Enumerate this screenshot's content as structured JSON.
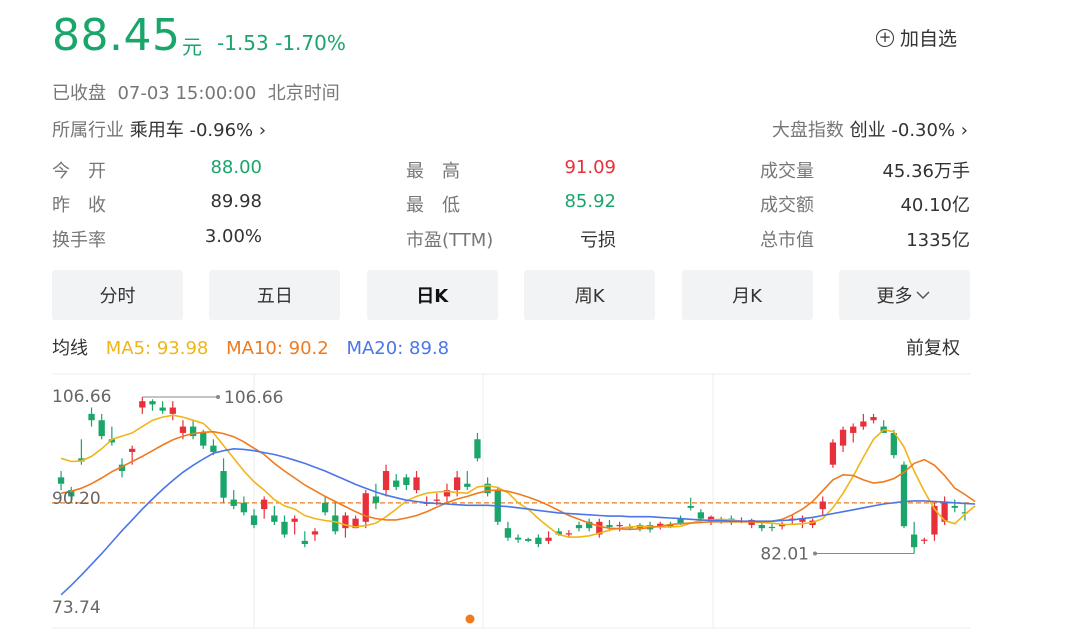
{
  "quote": {
    "price": "88.45",
    "unit": "元",
    "change": "-1.53",
    "change_pct": "-1.70%",
    "add_favorite": "加自选",
    "status": "已收盘",
    "datetime": "07-03 15:00:00",
    "timezone": "北京时间"
  },
  "industry": {
    "label": "所属行业",
    "name": "乘用车",
    "change": "-0.96%",
    "arrow": "›"
  },
  "index": {
    "label": "大盘指数",
    "name": "创业",
    "change": "-0.30%",
    "arrow": "›"
  },
  "stats": [
    {
      "label": "今　开",
      "value": "88.00",
      "color": "green"
    },
    {
      "label": "昨　收",
      "value": "89.98",
      "color": "normal"
    },
    {
      "label": "换手率",
      "value": "3.00%",
      "color": "normal"
    },
    {
      "label": "最　高",
      "value": "91.09",
      "color": "red"
    },
    {
      "label": "最　低",
      "value": "85.92",
      "color": "green"
    },
    {
      "label": "市盈(TTM)",
      "value": "亏损",
      "color": "normal"
    },
    {
      "label": "成交量",
      "value": "45.36万手",
      "color": "normal"
    },
    {
      "label": "成交额",
      "value": "40.10亿",
      "color": "normal"
    },
    {
      "label": "总市值",
      "value": "1335亿",
      "color": "normal"
    }
  ],
  "tabs": [
    "分时",
    "五日",
    "日K",
    "周K",
    "月K",
    "更多"
  ],
  "active_tab": "日K",
  "ma": {
    "title": "均线",
    "ma5": "MA5: 93.98",
    "ma10": "MA10: 90.2",
    "ma20": "MA20: 89.8",
    "adjust": "前复权"
  },
  "colors": {
    "up": "#e8303a",
    "down": "#1aa56b",
    "ma5": "#f0b518",
    "ma10": "#f07a1f",
    "ma20": "#4a76e8"
  },
  "chart_data": {
    "type": "candlestick",
    "y_labels": [
      "106.66",
      "90.20",
      "73.74"
    ],
    "max_annotation": "106.66",
    "min_annotation": "82.01",
    "ylim": [
      73.74,
      106.66
    ],
    "reference_price": 89.98,
    "candles": [
      [
        94,
        95,
        92,
        93
      ],
      [
        92,
        92.5,
        90,
        91
      ],
      [
        97,
        100,
        96,
        96.5
      ],
      [
        104,
        105,
        102,
        103
      ],
      [
        103,
        104,
        100,
        100.5
      ],
      [
        100,
        102,
        99,
        99.5
      ],
      [
        96,
        97,
        94,
        95
      ],
      [
        98,
        99,
        96,
        98.5
      ],
      [
        105,
        106.66,
        104,
        106
      ],
      [
        106,
        106.3,
        104.5,
        105.5
      ],
      [
        105,
        106,
        104,
        104.5
      ],
      [
        104,
        106,
        103,
        105
      ],
      [
        101,
        103,
        100,
        102
      ],
      [
        102,
        103,
        100,
        100.5
      ],
      [
        101,
        101.5,
        98.5,
        99
      ],
      [
        99,
        100,
        97.5,
        98
      ],
      [
        95,
        97,
        90,
        90.8
      ],
      [
        90.5,
        92,
        89,
        89.5
      ],
      [
        90,
        91,
        88,
        88.5
      ],
      [
        88,
        89,
        86,
        86.5
      ],
      [
        89,
        91,
        87.5,
        90.5
      ],
      [
        88,
        89.5,
        86.5,
        87
      ],
      [
        87,
        88,
        84.5,
        85
      ],
      [
        87,
        88,
        85,
        87.5
      ],
      [
        84,
        85.5,
        83,
        83.5
      ],
      [
        85,
        86,
        84,
        85.5
      ],
      [
        90,
        91,
        88,
        88.5
      ],
      [
        88,
        90,
        85,
        85.5
      ],
      [
        86,
        88.5,
        84.5,
        88
      ],
      [
        86,
        88,
        86,
        87.5
      ],
      [
        87,
        92,
        86,
        91.5
      ],
      [
        91,
        93,
        89,
        90
      ],
      [
        92,
        96,
        91,
        95
      ],
      [
        93.5,
        94.5,
        92,
        92.5
      ],
      [
        94,
        94.5,
        92,
        92.8
      ],
      [
        92,
        95,
        91.5,
        94
      ],
      [
        90,
        91,
        89.5,
        90
      ],
      [
        90.5,
        91.5,
        89.6,
        90.5
      ],
      [
        91,
        93,
        90,
        92
      ],
      [
        92,
        95,
        91,
        94
      ],
      [
        93,
        95,
        92,
        92.5
      ],
      [
        100,
        101,
        96.5,
        97
      ],
      [
        93,
        94,
        91,
        91.5
      ],
      [
        92,
        92.5,
        86.5,
        87
      ],
      [
        86,
        87,
        84,
        84.5
      ],
      [
        84.5,
        85,
        83.7,
        84.2
      ],
      [
        84.3,
        84.5,
        83.8,
        84
      ],
      [
        84.5,
        85,
        83,
        83.5
      ],
      [
        84,
        85.5,
        83.5,
        84.5
      ],
      [
        85.5,
        86,
        84.8,
        85
      ],
      [
        85,
        85.7,
        84.5,
        85.2
      ],
      [
        86.5,
        87,
        85.5,
        86
      ],
      [
        87,
        87.5,
        85.5,
        86
      ],
      [
        85,
        87.5,
        84.5,
        87
      ],
      [
        86.5,
        87.3,
        85.5,
        86.2
      ],
      [
        86.5,
        87,
        85.5,
        86.5
      ],
      [
        86.2,
        86.7,
        85.7,
        86
      ],
      [
        86.5,
        86.8,
        85.5,
        86
      ],
      [
        86.5,
        87,
        85.3,
        85.8
      ],
      [
        86.3,
        87,
        85.8,
        86.7
      ],
      [
        86.5,
        87,
        86,
        86.2
      ],
      [
        87.5,
        88,
        86.5,
        86.8
      ],
      [
        89.5,
        90.8,
        88.8,
        89.2
      ],
      [
        88.5,
        89,
        87,
        87.5
      ],
      [
        87,
        88,
        86.5,
        87.8
      ],
      [
        87.3,
        87.8,
        86.7,
        87
      ],
      [
        87.5,
        88,
        86.5,
        87
      ],
      [
        87,
        87.7,
        86.8,
        87.2
      ],
      [
        86.5,
        87.5,
        86,
        87.3
      ],
      [
        86.5,
        87,
        85.5,
        86
      ],
      [
        86.2,
        86.7,
        85.5,
        86.1
      ],
      [
        86.3,
        87,
        85.8,
        86.6
      ],
      [
        87.2,
        88,
        86.5,
        87.5
      ],
      [
        87,
        88,
        86,
        87.6
      ],
      [
        86.5,
        87.5,
        86,
        87.2
      ],
      [
        89,
        91,
        88,
        90.2
      ],
      [
        96,
        100,
        95.5,
        99.5
      ],
      [
        99,
        102,
        98,
        101.5
      ],
      [
        101,
        102.5,
        99.5,
        102
      ],
      [
        102,
        104,
        101.5,
        102.8
      ],
      [
        103,
        104,
        102.5,
        103.5
      ],
      [
        102,
        103,
        101,
        101
      ],
      [
        101,
        101.5,
        97,
        97.5
      ],
      [
        96,
        96.5,
        86,
        86.3
      ],
      [
        85,
        87,
        82.01,
        83
      ],
      [
        84,
        84.5,
        83.5,
        84.2
      ],
      [
        85,
        90,
        84,
        89.5
      ],
      [
        87,
        91,
        86.5,
        90
      ],
      [
        89.5,
        90.5,
        88.5,
        89.2
      ],
      [
        88.5,
        89.8,
        87.2,
        88.45
      ]
    ],
    "series": [
      {
        "name": "MA5",
        "values": [
          97,
          96.5,
          96.6,
          97.3,
          98.5,
          100,
          100.5,
          101,
          102,
          103,
          103.5,
          103.8,
          103.5,
          103,
          102.5,
          101,
          99,
          97,
          95,
          93.3,
          92,
          90.5,
          89.5,
          89,
          88,
          87.5,
          87.2,
          87,
          86.5,
          86.2,
          86.4,
          86.8,
          87.8,
          89,
          90.3,
          91,
          91.5,
          91.7,
          91.8,
          91.6,
          91.5,
          92.5,
          92.7,
          92.4,
          91.6,
          90,
          89,
          87.5,
          86.2,
          85,
          84.6,
          84.6,
          84.8,
          85.2,
          85.7,
          86,
          86.2,
          86.3,
          86.3,
          86.2,
          86.2,
          86.3,
          86.8,
          87.2,
          87.3,
          87.4,
          87.3,
          87.1,
          87,
          86.9,
          86.8,
          86.6,
          86.6,
          86.7,
          86.9,
          87.5,
          89.2,
          91.5,
          94.2,
          97.2,
          100,
          101.5,
          101.2,
          98.8,
          95,
          91.8,
          89,
          87.2,
          86.7,
          88.2,
          89.5
        ]
      },
      {
        "name": "MA10",
        "values": [
          91.5,
          91.8,
          92.3,
          93,
          93.9,
          94.9,
          95.7,
          96.5,
          97.3,
          98.2,
          99.1,
          99.9,
          100.5,
          100.9,
          101.1,
          101.2,
          100.9,
          100.4,
          99.6,
          98.6,
          97.6,
          96.2,
          95,
          93.9,
          92.8,
          91.9,
          91,
          90.2,
          89.4,
          88.6,
          87.9,
          87.5,
          87.3,
          87.3,
          87.6,
          88,
          88.6,
          89.3,
          90,
          90.6,
          91,
          91.5,
          91.9,
          92,
          91.8,
          91.4,
          90.9,
          90.3,
          89.6,
          88.8,
          88,
          87.4,
          86.8,
          86.3,
          86,
          85.9,
          85.8,
          85.9,
          86.1,
          86.3,
          86.6,
          86.7,
          86.8,
          86.9,
          87,
          87,
          87,
          87,
          87,
          87,
          87.1,
          87.4,
          88.1,
          89,
          90.2,
          91.9,
          93.6,
          94.4,
          94.3,
          93.6,
          93.1,
          93.3,
          93.8,
          94.8,
          96.2,
          96.8,
          95.9,
          94.3,
          92.3,
          91.3,
          90.2
        ]
      },
      {
        "name": "MA20",
        "values": [
          75.5,
          77,
          78.6,
          80.3,
          82,
          83.8,
          85.6,
          87.3,
          89,
          90.6,
          92.1,
          93.5,
          94.8,
          95.9,
          96.9,
          97.8,
          98.2,
          98.5,
          98.4,
          98.2,
          97.9,
          97.6,
          97.2,
          96.7,
          96.2,
          95.6,
          95,
          94.3,
          93.6,
          92.9,
          92.3,
          91.7,
          91.2,
          90.8,
          90.4,
          90.2,
          90,
          89.9,
          89.8,
          89.7,
          89.6,
          89.6,
          89.6,
          89.5,
          89.4,
          89.2,
          89,
          88.8,
          88.6,
          88.4,
          88.3,
          88.2,
          88.1,
          88,
          87.9,
          87.9,
          87.8,
          87.8,
          87.8,
          87.7,
          87.6,
          87.5,
          87.4,
          87.3,
          87.2,
          87.2,
          87.1,
          87.1,
          87.1,
          87.1,
          87.1,
          87.2,
          87.3,
          87.5,
          87.7,
          88,
          88.3,
          88.6,
          88.9,
          89.2,
          89.5,
          89.8,
          90,
          90.2,
          90.3,
          90.3,
          90.2,
          90.1,
          90,
          89.9,
          89.8
        ]
      }
    ]
  }
}
